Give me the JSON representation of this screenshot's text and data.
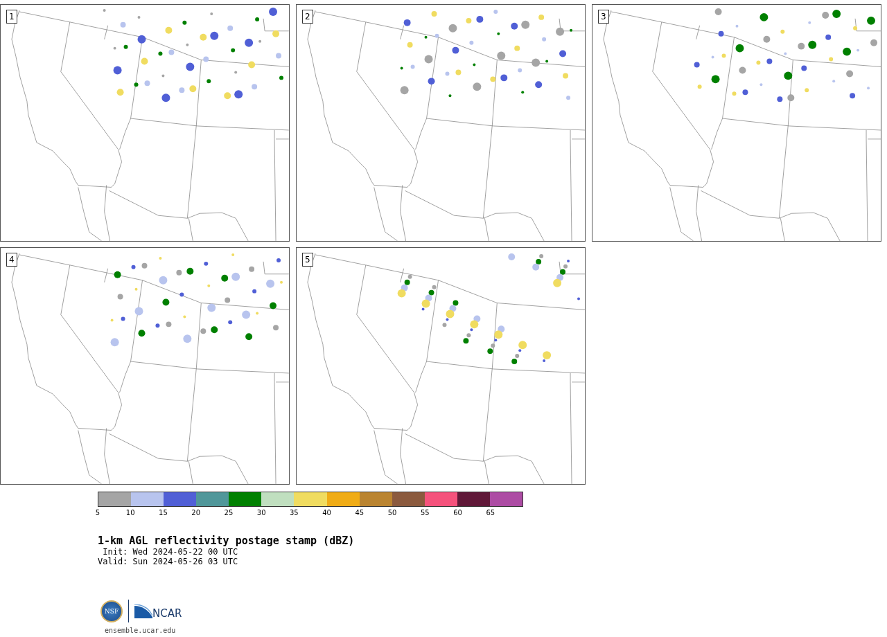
{
  "panels": [
    {
      "label": "1"
    },
    {
      "label": "2"
    },
    {
      "label": "3"
    },
    {
      "label": "4"
    },
    {
      "label": "5"
    }
  ],
  "colorbar": {
    "bins": [
      {
        "color": "#a5a5a5"
      },
      {
        "color": "#b8c4ee"
      },
      {
        "color": "#505fd6"
      },
      {
        "color": "#50979a"
      },
      {
        "color": "#008000"
      },
      {
        "color": "#c0dfbf"
      },
      {
        "color": "#f0dc60"
      },
      {
        "color": "#f0ac16"
      },
      {
        "color": "#ba8430"
      },
      {
        "color": "#8b5a3e"
      },
      {
        "color": "#f5527c"
      },
      {
        "color": "#601838"
      },
      {
        "color": "#ad4ca4"
      }
    ],
    "ticks": [
      "5",
      "10",
      "15",
      "20",
      "25",
      "30",
      "35",
      "40",
      "45",
      "50",
      "55",
      "60",
      "65"
    ]
  },
  "title": "1-km AGL reflectivity postage stamp (dBZ)",
  "init": " Init: Wed 2024-05-22 00 UTC",
  "valid": "Valid: Sun 2024-05-26 03 UTC",
  "logo": {
    "nsf": "NSF",
    "ncar": "NCAR"
  },
  "url": "ensemble.ucar.edu"
}
